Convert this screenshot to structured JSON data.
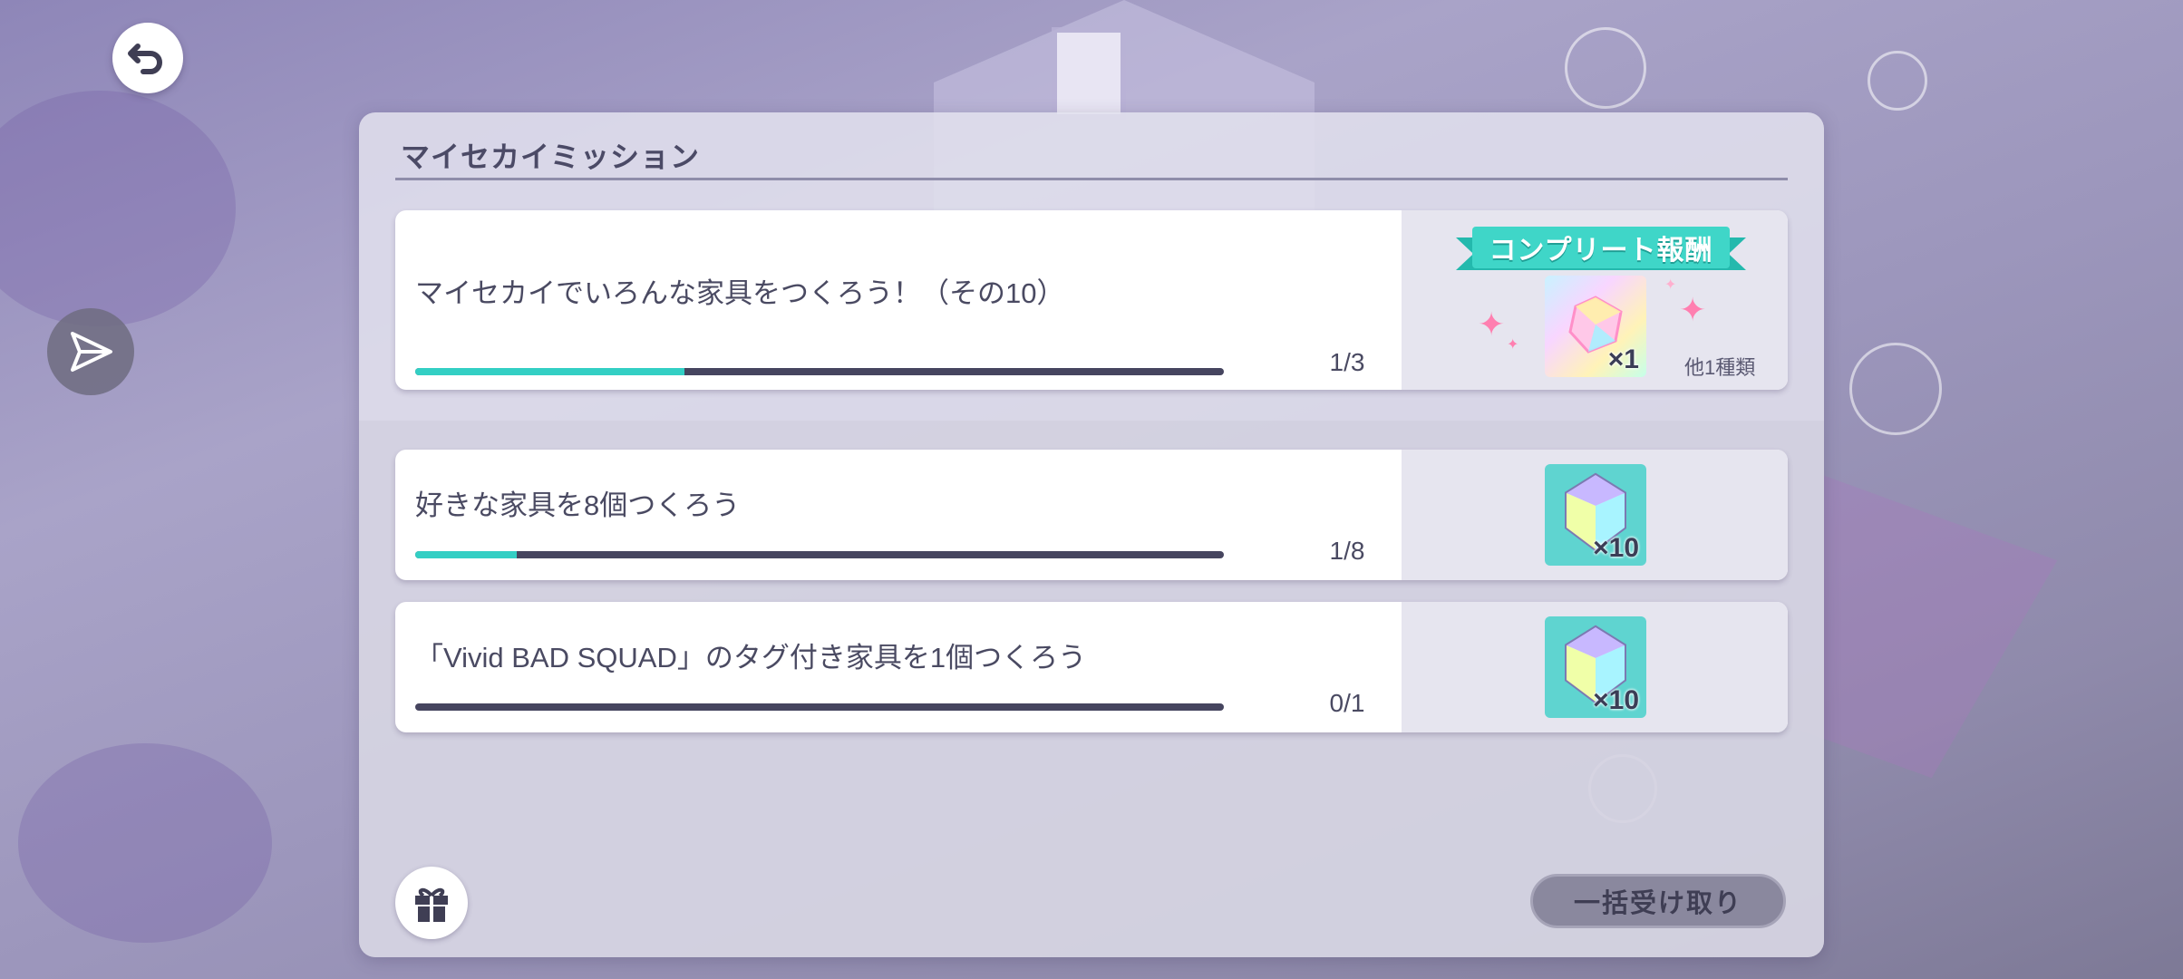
{
  "panel": {
    "title": "マイセカイミッション"
  },
  "missions": [
    {
      "text": "マイセカイでいろんな家具をつくろう！（その10）",
      "progress": 0.333,
      "count": "1/3",
      "reward": {
        "badge": "コンプリート報酬",
        "qty": "×1",
        "extra": "他1種類",
        "icon": "rainbow-crystal-icon"
      }
    },
    {
      "text": "好きな家具を8個つくろう",
      "progress": 0.125,
      "count": "1/8",
      "reward": {
        "qty": "×10",
        "icon": "crystal-icon"
      }
    },
    {
      "text": "「Vivid BAD SQUAD」のタグ付き家具を1個つくろう",
      "progress": 0,
      "count": "0/1",
      "reward": {
        "qty": "×10",
        "icon": "crystal-icon"
      }
    }
  ],
  "controls": {
    "claim_all_label": "一括受け取り",
    "gift_icon": "gift-icon",
    "back_icon": "back-arrow-icon",
    "share_icon": "paper-plane-icon"
  },
  "colors": {
    "accent": "#33cfc4",
    "bar_track": "#46455f",
    "badge": "#3fd6c8"
  }
}
